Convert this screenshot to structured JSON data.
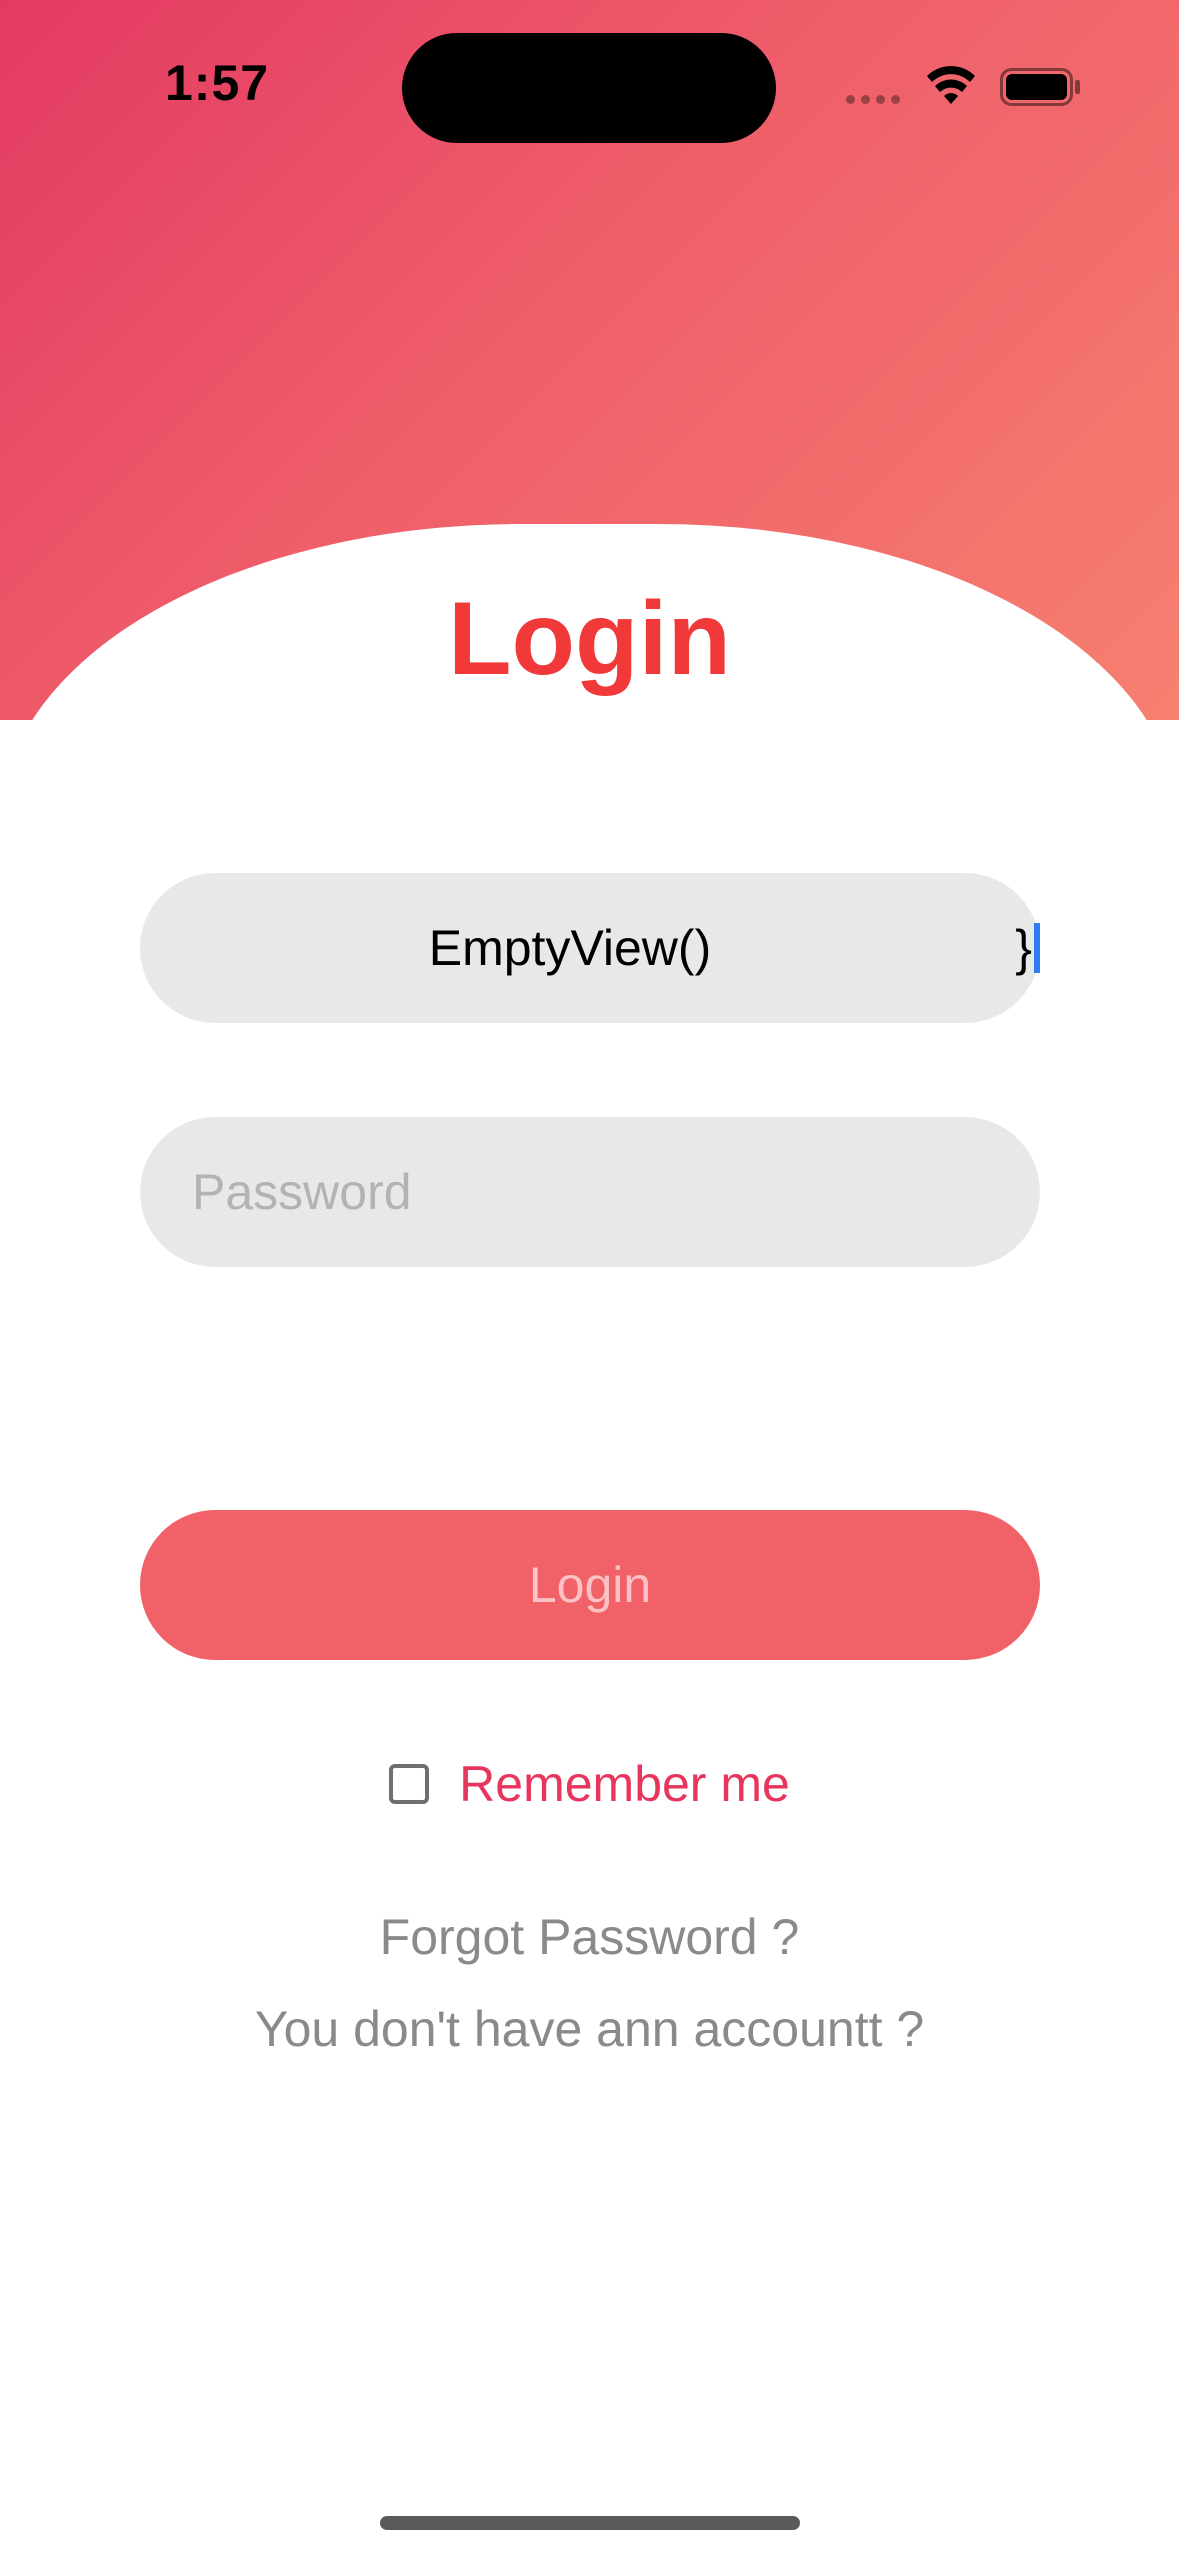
{
  "status_bar": {
    "time": "1:57"
  },
  "title": "Login",
  "email_field": {
    "value": "EmptyView()",
    "trailing_text": "}"
  },
  "password_field": {
    "placeholder": "Password",
    "value": ""
  },
  "login_button": {
    "label": "Login"
  },
  "remember_me": {
    "label": "Remember me",
    "checked": false
  },
  "links": {
    "forgot_password": "Forgot Password ?",
    "signup": "You don't have ann accountt ?"
  },
  "colors": {
    "gradient_start": "#e33a62",
    "gradient_end": "#f68070",
    "title": "#f1393a",
    "button_bg": "#f06267",
    "remember_label": "#e8355d",
    "field_bg": "#e8e8e8"
  },
  "icons": [
    "wifi-icon",
    "battery-icon",
    "checkbox-icon"
  ]
}
